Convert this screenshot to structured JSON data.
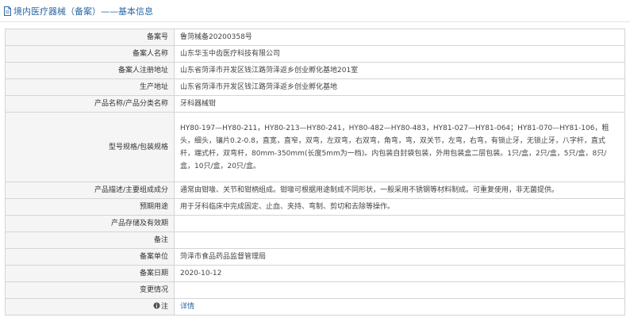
{
  "header": {
    "title": "境内医疗器械（备案）——基本信息",
    "accent_color": "#2b66a5"
  },
  "rows": [
    {
      "label": "备案号",
      "value": "鲁菏械备20200358号"
    },
    {
      "label": "备案人名称",
      "value": "山东华玉中齿医疗科技有限公司"
    },
    {
      "label": "备案人注册地址",
      "value": "山东省菏泽市开发区钱江路菏泽返乡创业孵化基地201室"
    },
    {
      "label": "生产地址",
      "value": "山东省菏泽市开发区钱江路菏泽返乡创业孵化基地"
    },
    {
      "label": "产品名称/产品分类名称",
      "value": "牙科器械钳"
    },
    {
      "label": "型号规格/包装规格",
      "value": "HY80-197—HY80-211，HY80-213—HY80-241，HY80-482—HY80-483，HY81-027—HY81-064；HY81-070—HY81-106，粗头，细头，镶片0.2-0.8，直宽，直窄，双弯，左双弯，右双弯，角弯，弯，双关节，左弯，右弯，有锁止牙，无锁止牙，八字杆，直式杆，端式杆，双弯杆，80mm-350mm(长度5mm为一档)。内包装自封袋包装，外用包装盒二层包装。1只/盒，2只/盒，5只/盒，8只/盒，10只/盒，20只/盒。"
    },
    {
      "label": "产品描述/主要组成成分",
      "value": "通常由钳喙、关节和钳柄组成。钳喙可根据用途制成不同形状，一般采用不锈钢等材料制成。可重复使用，非无菌提供。"
    },
    {
      "label": "预期用途",
      "value": "用于牙科临床中完成固定、止血、夹持、弯制、剪切和去除等操作。"
    },
    {
      "label": "产品存储及有效期",
      "value": ""
    },
    {
      "label": "备注",
      "value": ""
    },
    {
      "label": "备案单位",
      "value": "菏泽市食品药品监督管理局"
    },
    {
      "label": "备案日期",
      "value": "2020-10-12"
    },
    {
      "label": "变更情况",
      "value": ""
    }
  ],
  "note_row": {
    "label": "注",
    "link_text": "详情"
  }
}
